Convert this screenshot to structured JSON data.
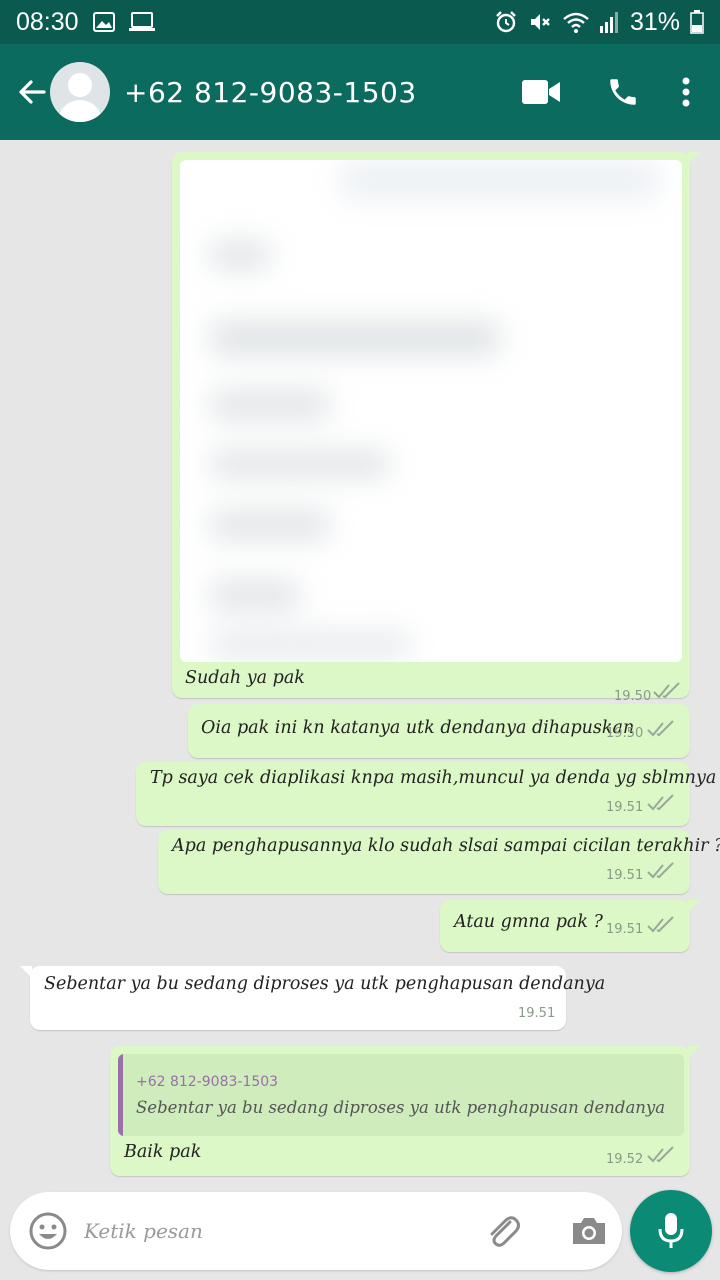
{
  "status_bar": {
    "time": "08:30",
    "battery": "31%",
    "icons": [
      "image-icon",
      "screen-icon",
      "alarm-icon",
      "mute-icon",
      "wifi-icon",
      "signal-icon",
      "battery-icon"
    ]
  },
  "header": {
    "contact": "+62 812-9083-1503",
    "icons": [
      "back-arrow-icon",
      "avatar-icon",
      "video-call-icon",
      "phone-icon",
      "more-vert-icon"
    ]
  },
  "messages": [
    {
      "kind": "image",
      "direction": "out",
      "caption": "Sudah ya pak",
      "time": "19.50"
    },
    {
      "kind": "text",
      "direction": "out",
      "text": "Oia pak ini kn katanya utk dendanya dihapuskan",
      "time": "19.50"
    },
    {
      "kind": "text",
      "direction": "out",
      "text": "Tp saya cek diaplikasi knpa masih,muncul ya denda yg sblmnya ?",
      "time": "19.51"
    },
    {
      "kind": "text",
      "direction": "out",
      "text": "Apa penghapusannya klo sudah slsai sampai cicilan terakhir ?",
      "time": "19.51"
    },
    {
      "kind": "text",
      "direction": "out",
      "text": "Atau gmna pak ?",
      "time": "19.51"
    },
    {
      "kind": "text",
      "direction": "in",
      "text": "Sebentar ya bu sedang diproses ya utk penghapusan dendanya",
      "time": "19.51"
    },
    {
      "kind": "reply",
      "direction": "out",
      "quoted_author": "+62 812-9083-1503",
      "quoted_text": "Sebentar ya bu sedang diproses ya utk penghapusan dendanya",
      "text": "Baik pak",
      "time": "19.52"
    }
  ],
  "composer": {
    "placeholder": "Ketik pesan",
    "icons": [
      "emoji-icon",
      "attach-icon",
      "camera-icon",
      "mic-icon"
    ]
  },
  "colors": {
    "header": "#0b6b5f",
    "status_bar": "#0b5a50",
    "outgoing_bubble": "#dcf8c6",
    "incoming_bubble": "#ffffff",
    "chat_background": "#e6e6e6",
    "mic_button": "#0b8a76"
  }
}
